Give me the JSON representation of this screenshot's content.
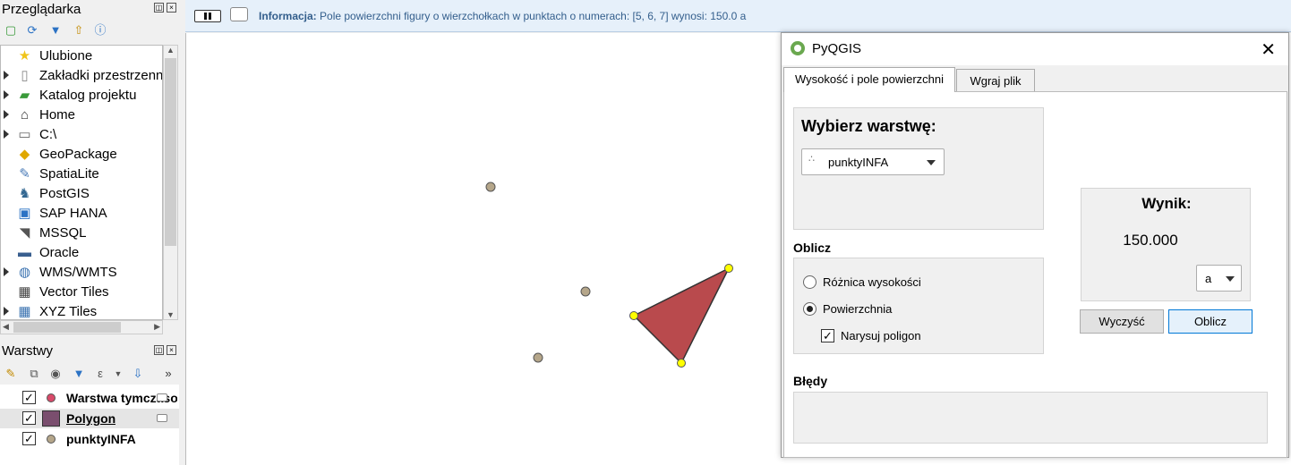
{
  "browser": {
    "title": "Przeglądarka",
    "items": [
      {
        "label": "Ulubione",
        "icon": "star-icon",
        "glyph": "★",
        "color": "#f0c419",
        "expandable": false
      },
      {
        "label": "Zakładki przestrzenne",
        "icon": "bookmarks-icon",
        "glyph": "▯",
        "color": "#888888",
        "expandable": true
      },
      {
        "label": "Katalog projektu",
        "icon": "project-folder-icon",
        "glyph": "▰",
        "color": "#3a9a3a",
        "expandable": true
      },
      {
        "label": "Home",
        "icon": "home-icon",
        "glyph": "⌂",
        "color": "#333333",
        "expandable": true
      },
      {
        "label": "C:\\",
        "icon": "drive-icon",
        "glyph": "▭",
        "color": "#666666",
        "expandable": true
      },
      {
        "label": "GeoPackage",
        "icon": "geopackage-icon",
        "glyph": "◆",
        "color": "#e0a800",
        "expandable": false
      },
      {
        "label": "SpatiaLite",
        "icon": "spatialite-icon",
        "glyph": "✎",
        "color": "#4a7bb7",
        "expandable": false
      },
      {
        "label": "PostGIS",
        "icon": "postgis-icon",
        "glyph": "♞",
        "color": "#336791",
        "expandable": false
      },
      {
        "label": "SAP HANA",
        "icon": "saphana-icon",
        "glyph": "▣",
        "color": "#2b72c4",
        "expandable": false
      },
      {
        "label": "MSSQL",
        "icon": "mssql-icon",
        "glyph": "◥",
        "color": "#555555",
        "expandable": false
      },
      {
        "label": "Oracle",
        "icon": "oracle-icon",
        "glyph": "▬",
        "color": "#3a5f8f",
        "expandable": false
      },
      {
        "label": "WMS/WMTS",
        "icon": "globe-icon",
        "glyph": "◍",
        "color": "#3a72b0",
        "expandable": true
      },
      {
        "label": "Vector Tiles",
        "icon": "vector-tiles-icon",
        "glyph": "▦",
        "color": "#444444",
        "expandable": false
      },
      {
        "label": "XYZ Tiles",
        "icon": "xyz-tiles-icon",
        "glyph": "▦",
        "color": "#3a72b0",
        "expandable": true
      }
    ]
  },
  "layers_panel": {
    "title": "Warstwy",
    "layers": [
      {
        "name": "Warstwa tymczasowa",
        "checked": true,
        "symbol": "dot",
        "color": "#d94a6a",
        "selected": false,
        "underline": false
      },
      {
        "name": "Polygon",
        "checked": true,
        "symbol": "square",
        "color": "#7a4e6e",
        "selected": true,
        "underline": true
      },
      {
        "name": "punktyINFA",
        "checked": true,
        "symbol": "dot",
        "color": "#b5a68a",
        "selected": false,
        "underline": false
      }
    ]
  },
  "message": {
    "prefix": "Informacja:",
    "text": " Pole powierzchni figury o wierzchołkach w punktach o numerach: [5, 6, 7] wynosi: 150.0 a"
  },
  "dialog": {
    "title": "PyQGIS",
    "tabs": [
      {
        "label": "Wysokość i pole powierzchni",
        "active": true
      },
      {
        "label": "Wgraj plik",
        "active": false
      }
    ],
    "select_layer_heading": "Wybierz warstwę:",
    "layer_combo_value": "punktyINFA",
    "compute_heading": "Oblicz",
    "options": [
      {
        "label": "Różnica wysokości",
        "checked": false
      },
      {
        "label": "Powierzchnia",
        "checked": true
      }
    ],
    "draw_polygon_label": "Narysuj poligon",
    "draw_polygon_checked": true,
    "result_heading": "Wynik:",
    "result_value": "150.000",
    "unit_value": "a",
    "clear_button": "Wyczyść",
    "compute_button": "Oblicz",
    "errors_heading": "Błędy",
    "errors_text": ""
  },
  "colors": {
    "polygon_fill": "#b94a4d",
    "vertex_highlight": "#ffff00",
    "point_fill": "#b5a68a"
  }
}
